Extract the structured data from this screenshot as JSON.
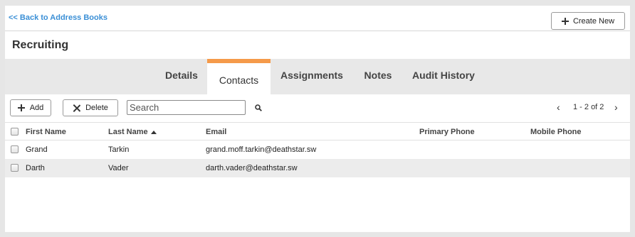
{
  "topbar": {
    "back_link": "<< Back to Address Books",
    "create_new_label": "Create New"
  },
  "page": {
    "title": "Recruiting"
  },
  "tabs": [
    {
      "label": "Details",
      "active": false
    },
    {
      "label": "Contacts",
      "active": true
    },
    {
      "label": "Assignments",
      "active": false
    },
    {
      "label": "Notes",
      "active": false
    },
    {
      "label": "Audit History",
      "active": false
    }
  ],
  "toolbar": {
    "add_label": "Add",
    "delete_label": "Delete",
    "search_placeholder": "Search",
    "pager_text": "1 - 2 of 2"
  },
  "table": {
    "columns": [
      "First Name",
      "Last Name",
      "Email",
      "Primary Phone",
      "Mobile Phone"
    ],
    "sorted_column": "Last Name",
    "sort_direction": "ascending",
    "rows": [
      [
        "Grand",
        "Tarkin",
        "grand.moff.tarkin@deathstar.sw",
        "",
        ""
      ],
      [
        "Darth",
        "Vader",
        "darth.vader@deathstar.sw",
        "",
        ""
      ]
    ]
  },
  "colors": {
    "link": "#3a8fd6",
    "active_tab_accent": "#f59a4a",
    "tabbar_bg": "#e8e8e8"
  }
}
